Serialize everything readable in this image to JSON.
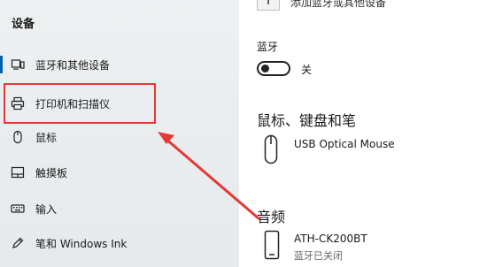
{
  "sidebar": {
    "title": "设备",
    "items": [
      {
        "label": "蓝牙和其他设备",
        "icon": "bluetooth-devices-icon"
      },
      {
        "label": "打印机和扫描仪",
        "icon": "printer-icon"
      },
      {
        "label": "鼠标",
        "icon": "mouse-icon"
      },
      {
        "label": "触摸板",
        "icon": "touchpad-icon"
      },
      {
        "label": "输入",
        "icon": "keyboard-icon"
      },
      {
        "label": "笔和 Windows Ink",
        "icon": "pen-icon"
      }
    ],
    "selected_index": 0,
    "highlight_color": "#e53935",
    "accent_color": "#0063b1"
  },
  "main": {
    "top_partial_text": "添加蓝牙或其他设备",
    "bluetooth": {
      "label": "蓝牙",
      "state": "关"
    },
    "mouse_section": {
      "heading": "鼠标、键盘和笔",
      "device_name": "USB Optical Mouse",
      "device_icon": "mouse-icon"
    },
    "audio_section": {
      "heading": "音频",
      "device_name": "ATH-CK200BT",
      "device_status": "蓝牙已关闭",
      "device_icon": "phone-icon"
    }
  }
}
